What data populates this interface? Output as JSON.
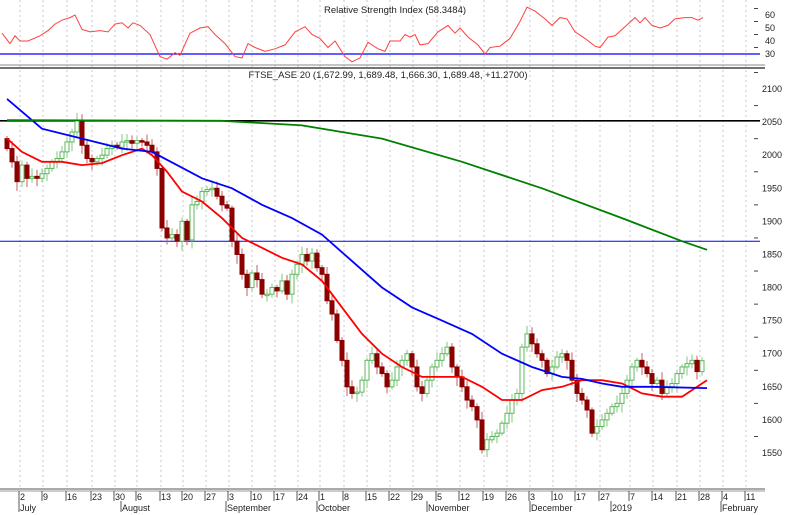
{
  "chart_data": {
    "type": "candlestick",
    "instrument": "FTSE_ASE 20",
    "title": "FTSE_ASE 20 (1,672.99, 1,689.48, 1,666.30, 1,689.48, +11.2700)",
    "last_ohlc": {
      "open": 1672.99,
      "high": 1689.48,
      "low": 1666.3,
      "close": 1689.48,
      "change": 11.27
    },
    "ylim": [
      1500,
      2130
    ],
    "y_ticks": [
      "2100",
      "2050",
      "2000",
      "1950",
      "1900",
      "1850",
      "1800",
      "1750",
      "1700",
      "1650",
      "1600",
      "1550"
    ],
    "closes": [
      2010,
      1990,
      1960,
      1985,
      1965,
      1968,
      1965,
      1972,
      1980,
      1990,
      1995,
      2005,
      2020,
      2035,
      2052,
      2015,
      1995,
      1990,
      1995,
      2000,
      2010,
      2015,
      2012,
      2020,
      2022,
      2018,
      2022,
      2020,
      2015,
      2005,
      1980,
      1890,
      1875,
      1880,
      1870,
      1900,
      1872,
      1925,
      1930,
      1945,
      1948,
      1950,
      1938,
      1925,
      1920,
      1870,
      1850,
      1820,
      1800,
      1822,
      1812,
      1790,
      1790,
      1800,
      1795,
      1810,
      1790,
      1820,
      1835,
      1850,
      1840,
      1852,
      1830,
      1820,
      1780,
      1760,
      1720,
      1690,
      1650,
      1640,
      1642,
      1660,
      1690,
      1700,
      1680,
      1670,
      1650,
      1660,
      1680,
      1690,
      1700,
      1680,
      1650,
      1640,
      1660,
      1680,
      1690,
      1700,
      1710,
      1680,
      1665,
      1650,
      1630,
      1620,
      1600,
      1555,
      1570,
      1575,
      1580,
      1595,
      1610,
      1630,
      1640,
      1710,
      1730,
      1715,
      1700,
      1690,
      1670,
      1680,
      1695,
      1700,
      1690,
      1660,
      1640,
      1630,
      1615,
      1580,
      1590,
      1600,
      1610,
      1620,
      1625,
      1640,
      1660,
      1680,
      1690,
      1680,
      1670,
      1655,
      1660,
      1640,
      1650,
      1655,
      1670,
      1680,
      1685,
      1690,
      1672.99,
      1689.48
    ],
    "moving_averages": [
      {
        "name": "short MA",
        "color": "#ff0000",
        "points": [
          [
            0,
            2025
          ],
          [
            3,
            2005
          ],
          [
            7,
            1990
          ],
          [
            11,
            1990
          ],
          [
            15,
            1985
          ],
          [
            19,
            1988
          ],
          [
            23,
            2000
          ],
          [
            27,
            2010
          ],
          [
            29,
            2000
          ],
          [
            32,
            1975
          ],
          [
            35,
            1945
          ],
          [
            39,
            1930
          ],
          [
            43,
            1905
          ],
          [
            47,
            1875
          ],
          [
            51,
            1860
          ],
          [
            55,
            1845
          ],
          [
            59,
            1835
          ],
          [
            63,
            1810
          ],
          [
            67,
            1770
          ],
          [
            71,
            1730
          ],
          [
            75,
            1700
          ],
          [
            79,
            1680
          ],
          [
            83,
            1665
          ],
          [
            87,
            1665
          ],
          [
            91,
            1665
          ],
          [
            95,
            1650
          ],
          [
            99,
            1630
          ],
          [
            103,
            1630
          ],
          [
            107,
            1645
          ],
          [
            111,
            1650
          ],
          [
            115,
            1660
          ],
          [
            119,
            1660
          ],
          [
            123,
            1655
          ],
          [
            127,
            1640
          ],
          [
            131,
            1635
          ],
          [
            135,
            1635
          ],
          [
            139,
            1655
          ],
          [
            140,
            1660
          ]
        ]
      },
      {
        "name": "medium MA",
        "color": "#0000ff",
        "points": [
          [
            0,
            2085
          ],
          [
            7,
            2040
          ],
          [
            15,
            2025
          ],
          [
            23,
            2010
          ],
          [
            29,
            2005
          ],
          [
            34,
            1985
          ],
          [
            39,
            1965
          ],
          [
            45,
            1950
          ],
          [
            51,
            1925
          ],
          [
            57,
            1905
          ],
          [
            63,
            1880
          ],
          [
            69,
            1840
          ],
          [
            75,
            1800
          ],
          [
            81,
            1770
          ],
          [
            87,
            1750
          ],
          [
            93,
            1730
          ],
          [
            99,
            1700
          ],
          [
            105,
            1680
          ],
          [
            111,
            1665
          ],
          [
            115,
            1662
          ],
          [
            119,
            1655
          ],
          [
            123,
            1650
          ],
          [
            129,
            1650
          ],
          [
            140,
            1648
          ]
        ]
      },
      {
        "name": "long MA",
        "color": "#008000",
        "points": [
          [
            0,
            2053
          ],
          [
            43,
            2052
          ],
          [
            59,
            2045
          ],
          [
            75,
            2025
          ],
          [
            91,
            1990
          ],
          [
            107,
            1950
          ],
          [
            123,
            1905
          ],
          [
            135,
            1870
          ],
          [
            140,
            1857
          ]
        ]
      }
    ],
    "horizontal_lines": [
      {
        "value": 2052,
        "color": "#000000"
      },
      {
        "value": 1870,
        "color": "#0000ff"
      }
    ],
    "rsi": {
      "title": "Relative Strength Index (58.3484)",
      "value": 58.3484,
      "ylim": [
        20,
        68
      ],
      "y_ticks": [
        "60",
        "50",
        "40",
        "30"
      ],
      "level": 30,
      "level_color": "#0000ff",
      "line_color": "#ff4040",
      "points": [
        [
          -1,
          46
        ],
        [
          0.6,
          38
        ],
        [
          1.6,
          44
        ],
        [
          2.6,
          40
        ],
        [
          4.2,
          40
        ],
        [
          6.6,
          44
        ],
        [
          8.2,
          48
        ],
        [
          9.6,
          53
        ],
        [
          11,
          56
        ],
        [
          12.6,
          58
        ],
        [
          13.6,
          60
        ],
        [
          15,
          49
        ],
        [
          16.6,
          47
        ],
        [
          18.6,
          48
        ],
        [
          20.2,
          47
        ],
        [
          21.6,
          53
        ],
        [
          23,
          54
        ],
        [
          24.2,
          50
        ],
        [
          25.2,
          54
        ],
        [
          26.6,
          52
        ],
        [
          28.6,
          45
        ],
        [
          30.6,
          28
        ],
        [
          32,
          26
        ],
        [
          33.6,
          31
        ],
        [
          34.6,
          29
        ],
        [
          36.6,
          46
        ],
        [
          38.6,
          50
        ],
        [
          40.2,
          51
        ],
        [
          41.6,
          45
        ],
        [
          43.6,
          38
        ],
        [
          45.6,
          28
        ],
        [
          47,
          27
        ],
        [
          48.2,
          38
        ],
        [
          49.6,
          35
        ],
        [
          51.6,
          32
        ],
        [
          53.6,
          34
        ],
        [
          55.6,
          37
        ],
        [
          56.6,
          42
        ],
        [
          57.6,
          47
        ],
        [
          59.6,
          51
        ],
        [
          61,
          45
        ],
        [
          62.6,
          42
        ],
        [
          64.2,
          35
        ],
        [
          65.6,
          40
        ],
        [
          67.6,
          28
        ],
        [
          69,
          24
        ],
        [
          70.6,
          27
        ],
        [
          72.2,
          39
        ],
        [
          74.2,
          34
        ],
        [
          75.6,
          32
        ],
        [
          76.6,
          40
        ],
        [
          78.6,
          40
        ],
        [
          79.6,
          45
        ],
        [
          80.6,
          43
        ],
        [
          81.6,
          45
        ],
        [
          82.6,
          37
        ],
        [
          84.2,
          38
        ],
        [
          86.2,
          47
        ],
        [
          88.2,
          52
        ],
        [
          89.6,
          46
        ],
        [
          90.6,
          50
        ],
        [
          92.2,
          43
        ],
        [
          94.2,
          37
        ],
        [
          95.6,
          30
        ],
        [
          96.6,
          35
        ],
        [
          98.6,
          36
        ],
        [
          100.6,
          42
        ],
        [
          102.6,
          55
        ],
        [
          104,
          66
        ],
        [
          105.6,
          63
        ],
        [
          107.6,
          57
        ],
        [
          109,
          52
        ],
        [
          110.6,
          58
        ],
        [
          112,
          57
        ],
        [
          113.6,
          47
        ],
        [
          115.6,
          42
        ],
        [
          117.6,
          36
        ],
        [
          118.6,
          35
        ],
        [
          120.2,
          43
        ],
        [
          121.6,
          44
        ],
        [
          123.6,
          51
        ],
        [
          125.6,
          58
        ],
        [
          126.6,
          54
        ],
        [
          127.6,
          58
        ],
        [
          129,
          52
        ],
        [
          130.6,
          50
        ],
        [
          132.2,
          52
        ],
        [
          133.6,
          57
        ],
        [
          135.6,
          58
        ],
        [
          137,
          58
        ],
        [
          138.2,
          56
        ],
        [
          139.2,
          58
        ]
      ]
    },
    "x_ticks": [
      "2",
      "9",
      "16",
      "23",
      "30",
      "6",
      "13",
      "20",
      "27",
      "3",
      "10",
      "17",
      "24",
      "1",
      "8",
      "15",
      "22",
      "29",
      "5",
      "12",
      "19",
      "26",
      "3",
      "10",
      "17",
      "27",
      "7",
      "14",
      "21",
      "28",
      "4",
      "11"
    ],
    "x_months": [
      "July",
      "August",
      "September",
      "October",
      "November",
      "December",
      "2019",
      "February"
    ],
    "colors": {
      "up_body": "#ffffff",
      "up_outline": "#5cb85c",
      "down_body": "#8b0000"
    }
  }
}
